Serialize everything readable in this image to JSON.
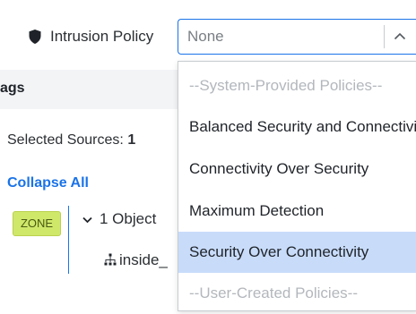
{
  "policy": {
    "label": "Intrusion Policy",
    "select_value": "None",
    "icons": {
      "label_icon": "shield-icon",
      "toggle_icon": "chevron-up-icon"
    }
  },
  "dropdown": {
    "options": [
      {
        "label": "--System-Provided Policies--",
        "kind": "group"
      },
      {
        "label": "Balanced Security and Connectivity",
        "kind": "option"
      },
      {
        "label": "Connectivity Over Security",
        "kind": "option"
      },
      {
        "label": "Maximum Detection",
        "kind": "option"
      },
      {
        "label": "Security Over Connectivity",
        "kind": "option",
        "highlighted": true
      },
      {
        "label": "--User-Created Policies--",
        "kind": "group"
      }
    ]
  },
  "left_panel": {
    "tags_header": "ags",
    "selected_sources_label": "Selected Sources:",
    "selected_sources_count": "1",
    "collapse_all": "Collapse All",
    "zone_badge": "ZONE",
    "object_group": "1 Object",
    "object_item": "inside_",
    "icons": {
      "group_toggle": "chevron-down-icon",
      "object": "network-icon"
    }
  },
  "colors": {
    "accent": "#1a73e8",
    "highlight": "#c8dcfa",
    "zone_badge": "#cfe86a",
    "group_text": "#b3b7bc"
  }
}
